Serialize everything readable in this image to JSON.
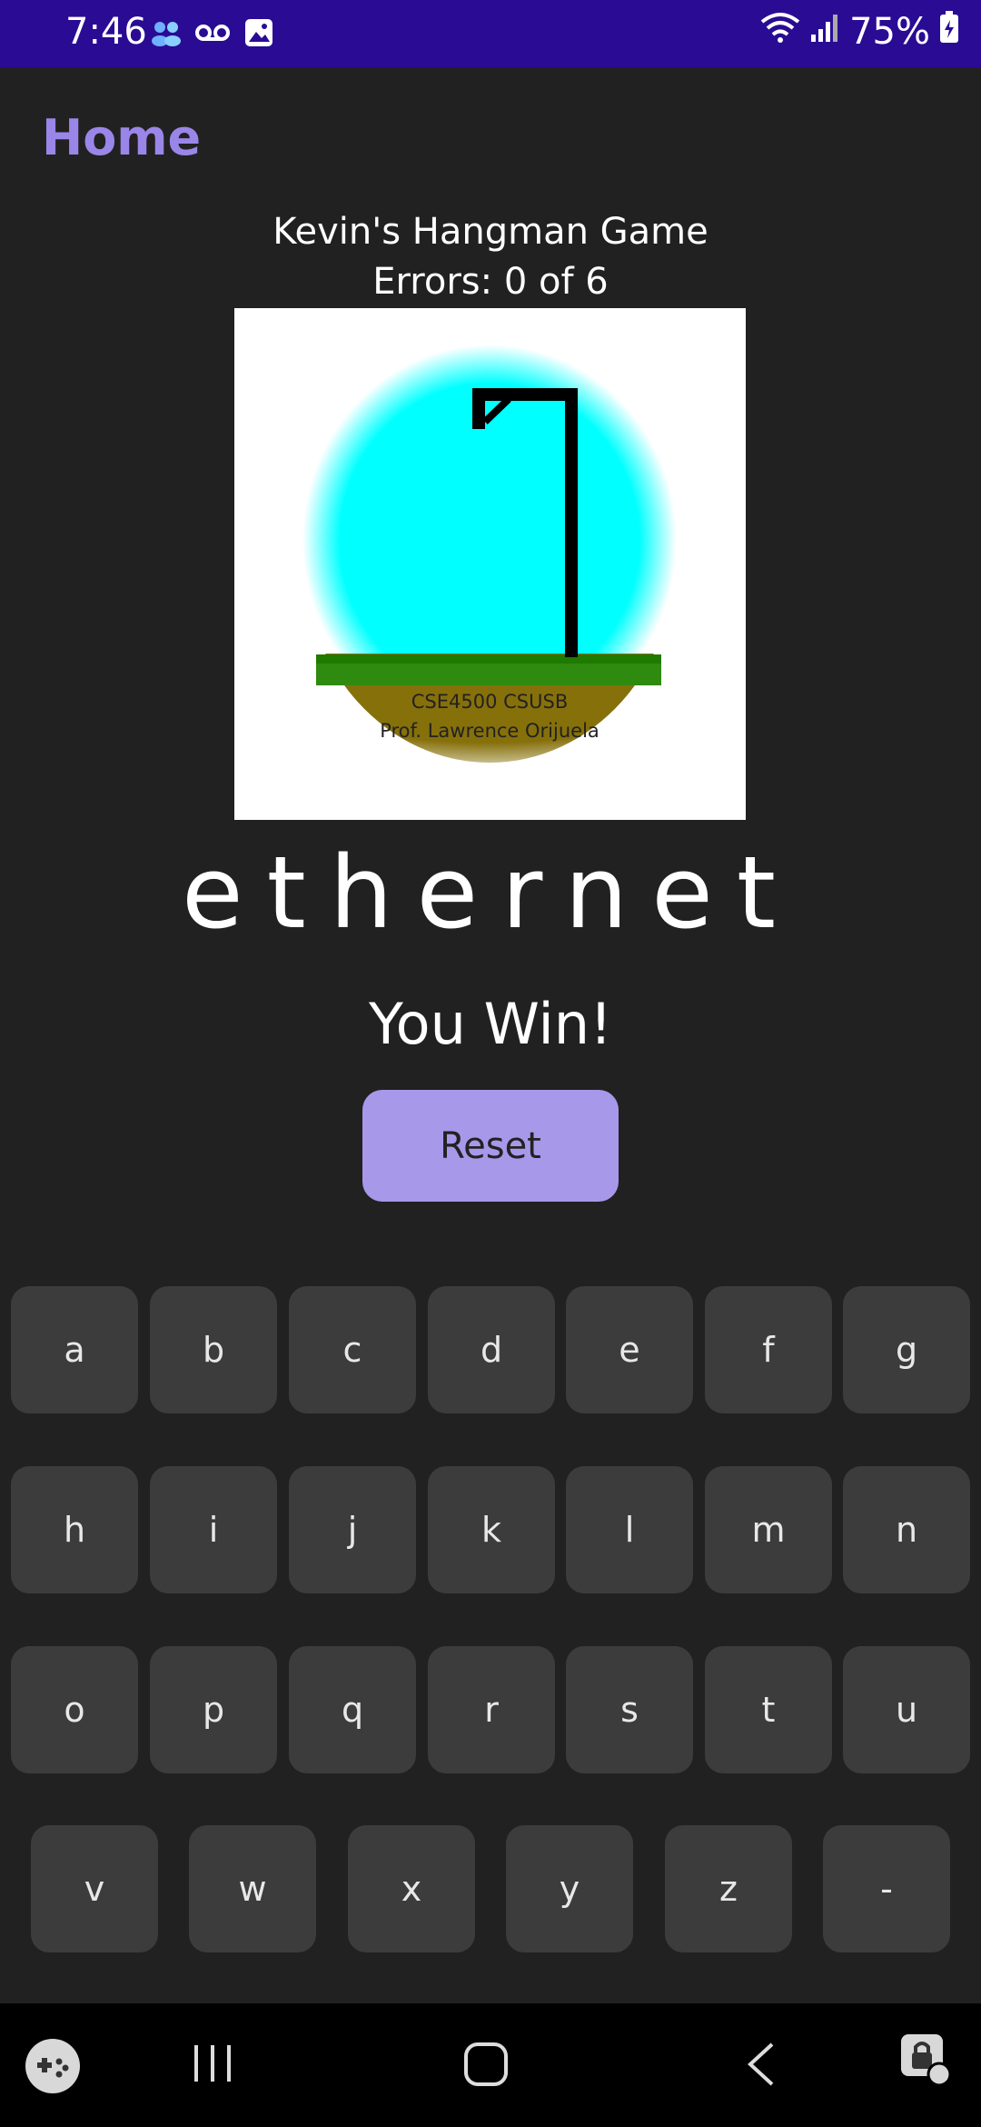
{
  "status_bar": {
    "time": "7:46",
    "battery": "75%",
    "icons_left": [
      "people-icon",
      "voicemail-icon",
      "image-icon"
    ],
    "icons_right": [
      "wifi-icon",
      "signal-icon",
      "battery-icon"
    ]
  },
  "app_bar": {
    "title": "Home"
  },
  "game": {
    "title": "Kevin's Hangman Game",
    "errors": "Errors: 0 of 6",
    "image_caption_line1": "CSE4500 CSUSB",
    "image_caption_line2": "Prof. Lawrence Orijuela",
    "word": "ethernet",
    "result": "You Win!",
    "reset_label": "Reset"
  },
  "keyboard": {
    "rows": [
      [
        "a",
        "b",
        "c",
        "d",
        "e",
        "f",
        "g"
      ],
      [
        "h",
        "i",
        "j",
        "k",
        "l",
        "m",
        "n"
      ],
      [
        "o",
        "p",
        "q",
        "r",
        "s",
        "t",
        "u"
      ],
      [
        "v",
        "w",
        "x",
        "y",
        "z",
        "-"
      ]
    ]
  },
  "nav_bar": {
    "icons": [
      "game-launcher-icon",
      "recent-apps-icon",
      "home-icon",
      "back-icon",
      "secure-lock-icon"
    ]
  },
  "colors": {
    "status_bar": "#2a0b94",
    "accent": "#9a86e8",
    "button": "#a898ea",
    "background": "#212121",
    "key": "#3c3c3c"
  }
}
